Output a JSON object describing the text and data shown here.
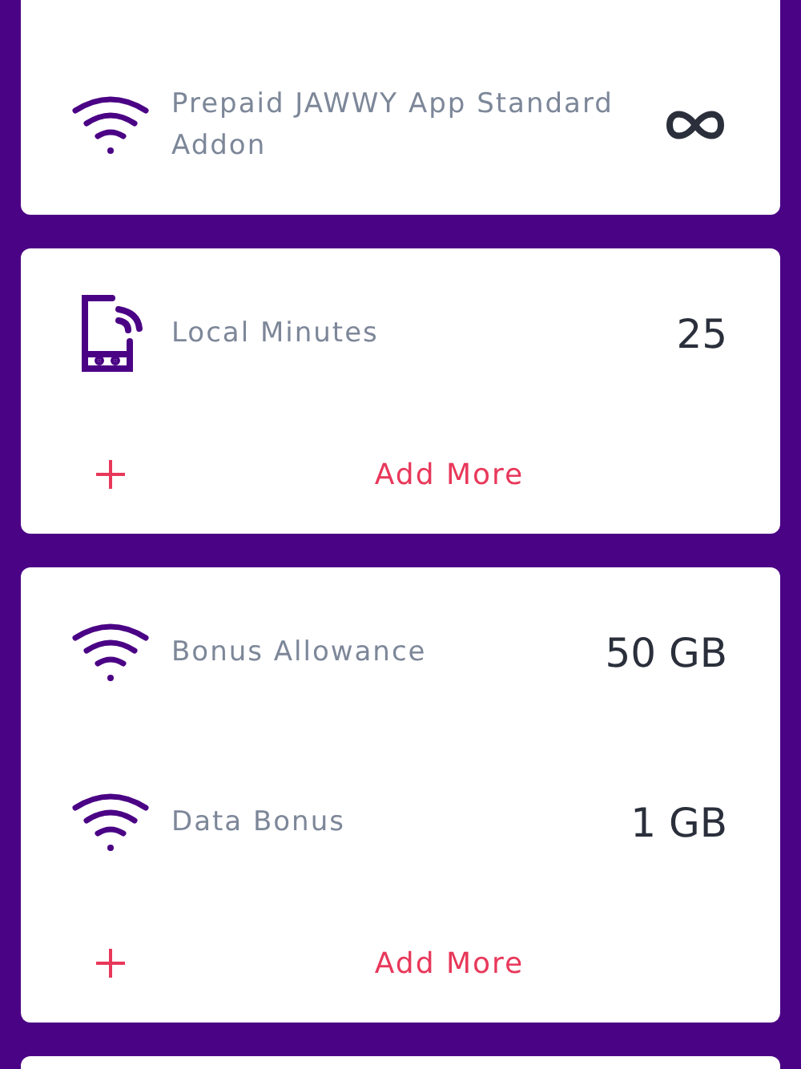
{
  "cards": [
    {
      "items": [
        {
          "kind": "wifi",
          "label": "Prepaid JAWWY App Standard Addon"
        }
      ]
    },
    {
      "items": [
        {
          "kind": "phone",
          "label": "Local Minutes",
          "value": "25"
        }
      ],
      "action": "Add More"
    },
    {
      "items": [
        {
          "kind": "wifi",
          "label": "Bonus Allowance",
          "value": "50 GB"
        },
        {
          "kind": "wifi",
          "label": "Data Bonus",
          "value": "1 GB"
        }
      ],
      "action": "Add More"
    }
  ]
}
